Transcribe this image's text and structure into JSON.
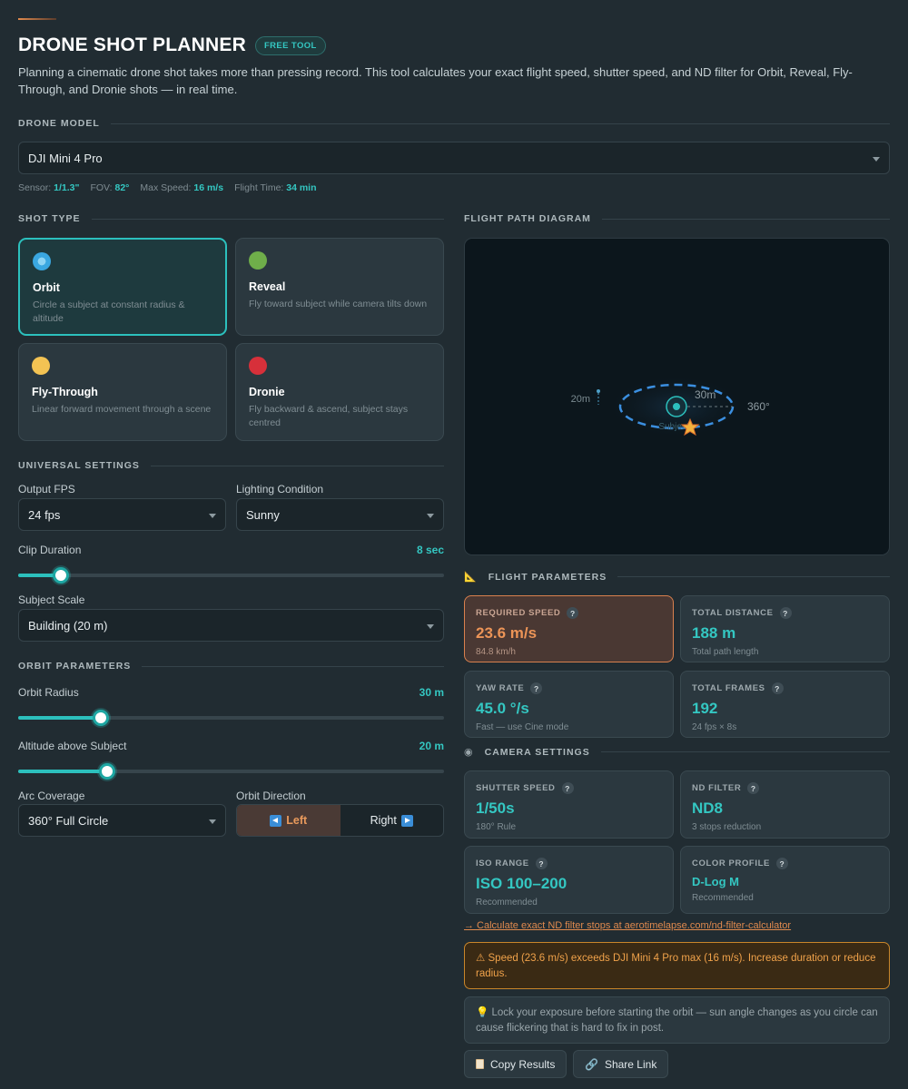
{
  "header": {
    "title": "DRONE SHOT PLANNER",
    "badge": "FREE TOOL",
    "intro": "Planning a cinematic drone shot takes more than pressing record. This tool calculates your exact flight speed, shutter speed, and ND filter for Orbit, Reveal, Fly-Through, and Dronie shots — in real time."
  },
  "drone_model": {
    "section_title": "DRONE MODEL",
    "selected": "DJI Mini 4 Pro",
    "specs": [
      {
        "label": "Sensor:",
        "value": "1/1.3\""
      },
      {
        "label": "FOV:",
        "value": "82°"
      },
      {
        "label": "Max Speed:",
        "value": "16 m/s"
      },
      {
        "label": "Flight Time:",
        "value": "34 min"
      }
    ]
  },
  "shot_type": {
    "section_title": "SHOT TYPE",
    "cards": [
      {
        "name": "Orbit",
        "desc": "Circle a subject at constant radius & altitude",
        "color": "#3aa7e0",
        "active": true
      },
      {
        "name": "Reveal",
        "desc": "Fly toward subject while camera tilts down",
        "color": "#6fae4a",
        "active": false
      },
      {
        "name": "Fly-Through",
        "desc": "Linear forward movement through a scene",
        "color": "#f3c353",
        "active": false
      },
      {
        "name": "Dronie",
        "desc": "Fly backward & ascend, subject stays centred",
        "color": "#d7303a",
        "active": false
      }
    ]
  },
  "universal": {
    "section_title": "UNIVERSAL SETTINGS",
    "fps_label": "Output FPS",
    "fps_value": "24 fps",
    "lighting_label": "Lighting Condition",
    "lighting_value": "Sunny",
    "clip_label": "Clip Duration",
    "clip_value": "8 sec",
    "clip_fraction": 0.1,
    "scale_label": "Subject Scale",
    "scale_value": "Building (20 m)"
  },
  "orbit": {
    "section_title": "ORBIT PARAMETERS",
    "radius_label": "Orbit Radius",
    "radius_value": "30 m",
    "radius_fraction": 0.195,
    "altitude_label": "Altitude above Subject",
    "altitude_value": "20 m",
    "altitude_fraction": 0.21,
    "arc_label": "Arc Coverage",
    "arc_value": "360° Full Circle",
    "direction_label": "Orbit Direction",
    "direction_left": "Left",
    "direction_right": "Right",
    "direction_selected": "Left"
  },
  "diagram": {
    "section_title": "FLIGHT PATH DIAGRAM",
    "altitude": "20m",
    "radius": "30m",
    "arc": "360°",
    "subject": "Subject"
  },
  "flight_params": {
    "section_title": "FLIGHT PARAMETERS",
    "cards": [
      {
        "title": "REQUIRED SPEED",
        "value": "23.6 m/s",
        "sub": "84.8 km/h",
        "warn": true
      },
      {
        "title": "TOTAL DISTANCE",
        "value": "188 m",
        "sub": "Total path length",
        "warn": false
      },
      {
        "title": "YAW RATE",
        "value": "45.0 °/s",
        "sub": "Fast — use Cine mode",
        "warn": false
      },
      {
        "title": "TOTAL FRAMES",
        "value": "192",
        "sub": "24 fps × 8s",
        "warn": false
      }
    ]
  },
  "camera": {
    "section_title": "CAMERA SETTINGS",
    "cards": [
      {
        "title": "SHUTTER SPEED",
        "value": "1/50s",
        "sub": "180° Rule"
      },
      {
        "title": "ND FILTER",
        "value": "ND8",
        "sub": "3 stops reduction"
      },
      {
        "title": "ISO RANGE",
        "value": "ISO 100–200",
        "sub": "Recommended"
      },
      {
        "title": "COLOR PROFILE",
        "value": "D-Log M",
        "sub": "Recommended"
      }
    ]
  },
  "nd_link": "→ Calculate exact ND filter stops at aerotimelapse.com/nd-filter-calculator",
  "alert": "⚠ Speed (23.6 m/s) exceeds DJI Mini 4 Pro max (16 m/s). Increase duration or reduce radius.",
  "tip": "💡 Lock your exposure before starting the orbit — sun angle changes as you circle can cause flickering that is hard to fix in post.",
  "actions": {
    "copy": "Copy Results",
    "share": "Share Link"
  },
  "colors": {
    "accent": "#2cc0bd",
    "warn": "#ec9457",
    "bg": "#212c32"
  }
}
